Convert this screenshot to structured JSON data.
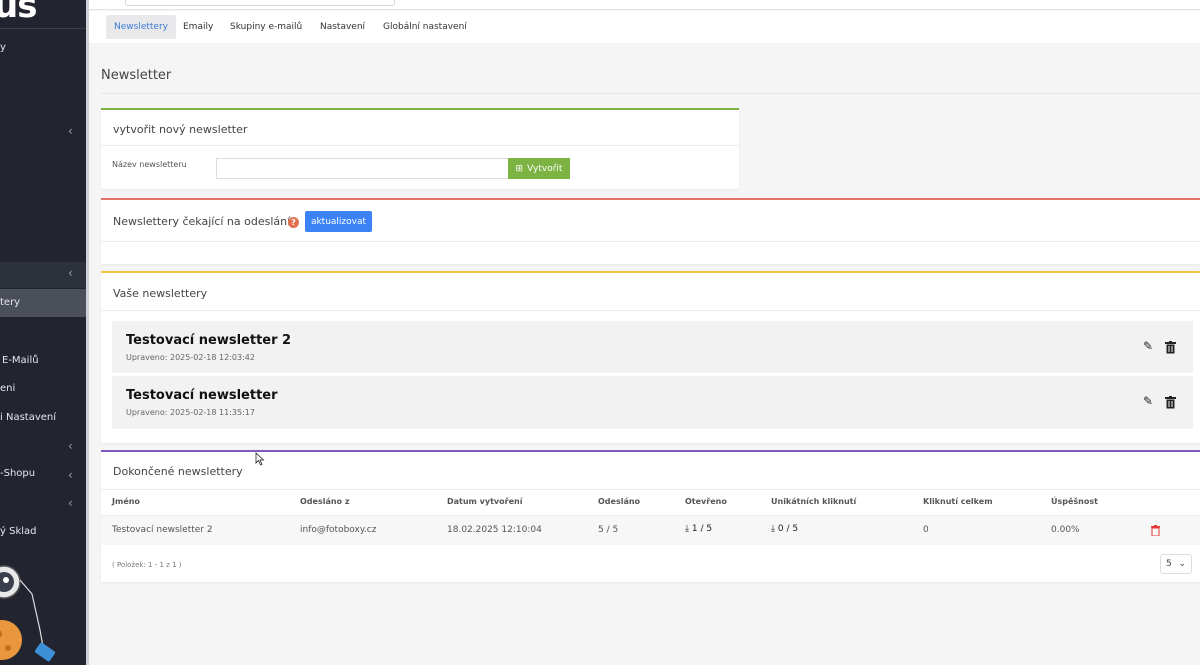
{
  "sidebar": {
    "logo": "us",
    "fragments": [
      {
        "text": "y"
      },
      {
        "text": "tery"
      },
      {
        "text": "E-Mailů"
      },
      {
        "text": "eni"
      },
      {
        "text": "i Nastavení"
      },
      {
        "text": "-Shopu"
      },
      {
        "text": "ý Sklad"
      }
    ]
  },
  "tabs": [
    "Newslettery",
    "Emaily",
    "Skupiny e-mailů",
    "Nastavení",
    "Globální nastavení"
  ],
  "page_title": "Newsletter",
  "create": {
    "header": "vytvořit nový newsletter",
    "label": "Název newsletteru",
    "input_value": "",
    "button": "Vytvořit"
  },
  "pending": {
    "header": "Newslettery čekající na odeslání",
    "help": "?",
    "button": "aktualizovat"
  },
  "yours": {
    "header": "Vaše newslettery",
    "items": [
      {
        "title": "Testovací newsletter 2",
        "updated": "Upraveno: 2025-02-18 12:03:42"
      },
      {
        "title": "Testovací newsletter",
        "updated": "Upraveno: 2025-02-18 11:35:17"
      }
    ]
  },
  "done": {
    "header": "Dokončené newslettery",
    "columns": [
      "Jméno",
      "Odesláno z",
      "Datum vytvoření",
      "Odesláno",
      "Otevřeno",
      "Unikátních kliknutí",
      "Kliknutí celkem",
      "Úspěšnost"
    ],
    "rows": [
      {
        "name": "Testovací newsletter 2",
        "from": "info@fotoboxy.cz",
        "created": "18.02.2025 12:10:04",
        "sent": "5 / 5",
        "opened": "1 / 5",
        "unique_clicks": "0 / 5",
        "total_clicks": "0",
        "success": "0.00%"
      }
    ],
    "pager_info": "( Položek: 1 - 1 z 1 )",
    "per_page": "5"
  },
  "colors": {
    "accent_green": "#7cb342",
    "accent_red": "#e57368",
    "accent_yellow": "#f4c542",
    "accent_purple": "#7e57c2",
    "button_blue": "#3b82f6"
  }
}
